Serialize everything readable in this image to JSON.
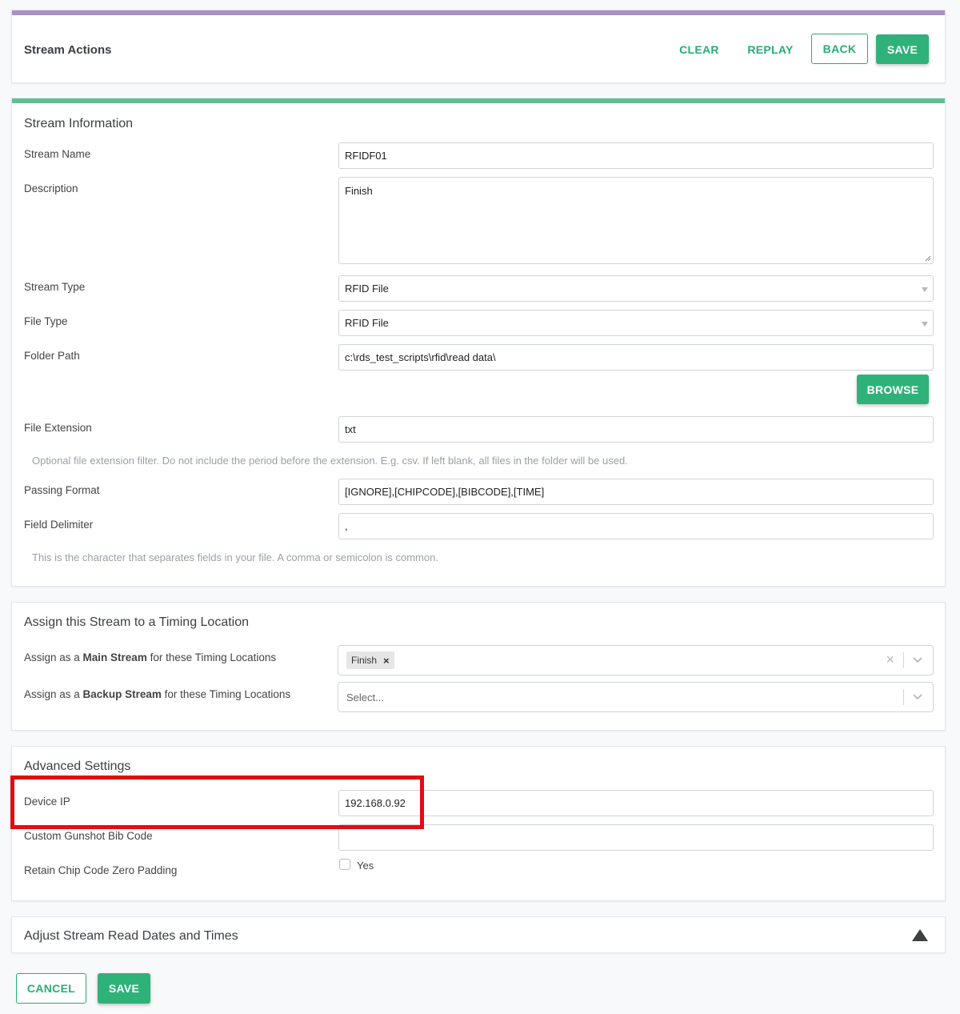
{
  "actions": {
    "title": "Stream Actions",
    "clear": "CLEAR",
    "replay": "REPLAY",
    "back": "BACK",
    "save": "SAVE"
  },
  "stream_info": {
    "title": "Stream Information",
    "stream_name_label": "Stream Name",
    "stream_name_value": "RFIDF01",
    "description_label": "Description",
    "description_value": "Finish",
    "stream_type_label": "Stream Type",
    "stream_type_value": "RFID File",
    "file_type_label": "File Type",
    "file_type_value": "RFID File",
    "folder_path_label": "Folder Path",
    "folder_path_value": "c:\\rds_test_scripts\\rfid\\read data\\",
    "browse": "BROWSE",
    "file_extension_label": "File Extension",
    "file_extension_value": "txt",
    "file_extension_help": "Optional file extension filter. Do not include the period before the extension. E.g. csv. If left blank, all files in the folder will be used.",
    "passing_format_label": "Passing Format",
    "passing_format_value": "[IGNORE],[CHIPCODE],[BIBCODE],[TIME]",
    "field_delimiter_label": "Field Delimiter",
    "field_delimiter_value": ",",
    "field_delimiter_help": "This is the character that separates fields in your file. A comma or semicolon is common."
  },
  "timing": {
    "title": "Assign this Stream to a Timing Location",
    "main_prefix": "Assign as a ",
    "main_bold": "Main Stream",
    "main_suffix": " for these Timing Locations",
    "main_selected": [
      "Finish"
    ],
    "backup_prefix": "Assign as a ",
    "backup_bold": "Backup Stream",
    "backup_suffix": " for these Timing Locations",
    "backup_placeholder": "Select..."
  },
  "advanced": {
    "title": "Advanced Settings",
    "device_ip_label": "Device IP",
    "device_ip_value": "192.168.0.92",
    "gunshot_label": "Custom Gunshot Bib Code",
    "gunshot_value": "",
    "zero_padding_label": "Retain Chip Code Zero Padding",
    "zero_padding_checkbox_label": "Yes",
    "zero_padding_checked": false
  },
  "adjust": {
    "title": "Adjust Stream Read Dates and Times"
  },
  "footer": {
    "cancel": "CANCEL",
    "save": "SAVE"
  },
  "colors": {
    "accent_green": "#2fb27a",
    "actions_bar": "#a890c8",
    "info_bar": "#5fbf94",
    "highlight_red": "#e10d10"
  }
}
